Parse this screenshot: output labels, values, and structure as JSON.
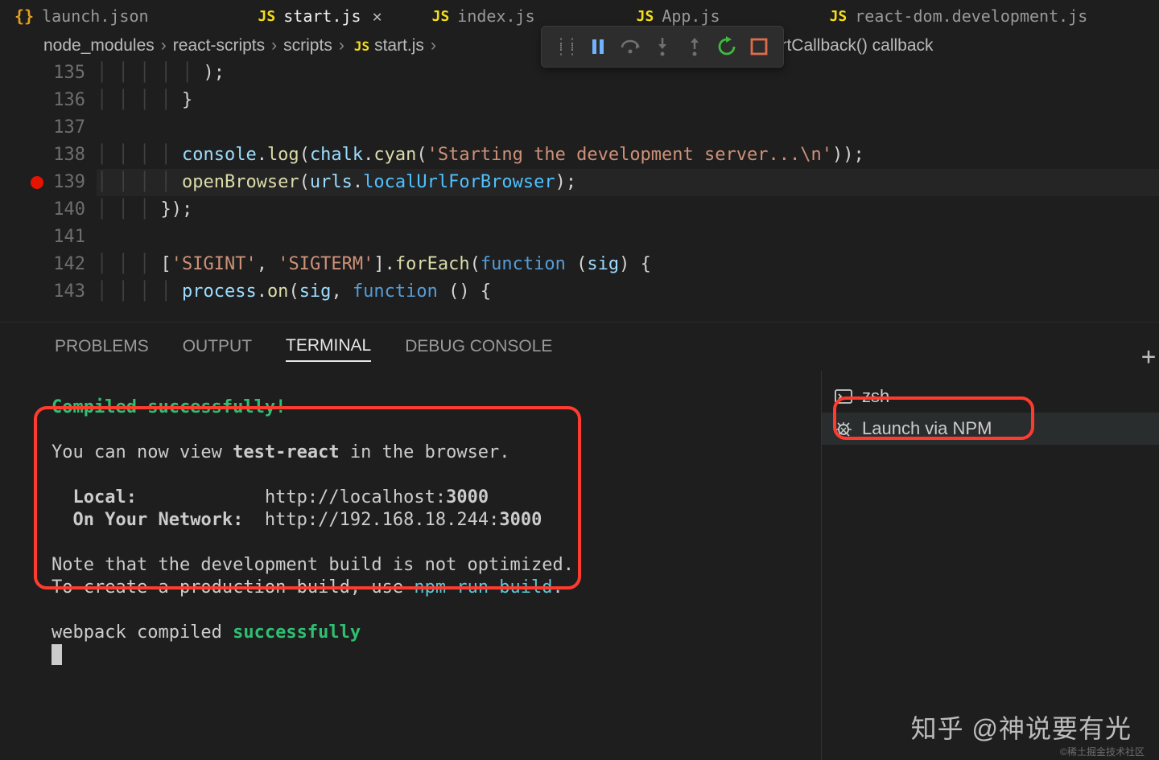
{
  "tabs": [
    {
      "icon": "{}",
      "label": "launch.json"
    },
    {
      "icon": "JS",
      "label": "start.js",
      "active": true
    },
    {
      "icon": "JS",
      "label": "index.js"
    },
    {
      "icon": "JS",
      "label": "App.js"
    },
    {
      "icon": "JS",
      "label": "react-dom.development.js"
    }
  ],
  "breadcrumb": {
    "parts": [
      "node_modules",
      "react-scripts",
      "scripts",
      "start.js"
    ],
    "js_icon": "JS",
    "tail": "erver.startCallback() callback"
  },
  "debug_toolbar": {
    "buttons": [
      "grip",
      "pause",
      "step-over",
      "step-into",
      "step-out",
      "restart",
      "stop"
    ]
  },
  "editor": {
    "lines": [
      {
        "num": "135",
        "indent": 5,
        "code_html": "<span class='tok-punc'>);</span>"
      },
      {
        "num": "136",
        "indent": 4,
        "code_html": "<span class='tok-punc'>}</span>"
      },
      {
        "num": "137",
        "indent": 0,
        "code_html": ""
      },
      {
        "num": "138",
        "indent": 4,
        "code_html": "<span class='tok-obj'>console</span><span class='tok-punc'>.</span><span class='tok-fn'>log</span><span class='tok-punc'>(</span><span class='tok-obj'>chalk</span><span class='tok-punc'>.</span><span class='tok-fn'>cyan</span><span class='tok-punc'>(</span><span class='tok-str'>'Starting the development server...\\n'</span><span class='tok-punc'>));</span>"
      },
      {
        "num": "139",
        "indent": 4,
        "bp": true,
        "hl": true,
        "code_html": "<span class='tok-fn'>openBrowser</span><span class='tok-punc'>(</span><span class='tok-obj'>urls</span><span class='tok-punc'>.</span><span class='tok-var'>localUrlForBrowser</span><span class='tok-punc'>);</span>"
      },
      {
        "num": "140",
        "indent": 3,
        "code_html": "<span class='tok-punc'>});</span>"
      },
      {
        "num": "141",
        "indent": 0,
        "code_html": ""
      },
      {
        "num": "142",
        "indent": 3,
        "code_html": "<span class='tok-punc'>[</span><span class='tok-str'>'SIGINT'</span><span class='tok-punc'>, </span><span class='tok-str'>'SIGTERM'</span><span class='tok-punc'>].</span><span class='tok-fn'>forEach</span><span class='tok-punc'>(</span><span class='tok-kw'>function</span><span class='tok-punc'> (</span><span class='tok-obj'>sig</span><span class='tok-punc'>) {</span>"
      },
      {
        "num": "143",
        "indent": 4,
        "code_html": "<span class='tok-obj'>process</span><span class='tok-punc'>.</span><span class='tok-fn'>on</span><span class='tok-punc'>(</span><span class='tok-obj'>sig</span><span class='tok-punc'>, </span><span class='tok-kw'>function</span><span class='tok-punc'> () {</span>"
      }
    ]
  },
  "panel": {
    "tabs": [
      "PROBLEMS",
      "OUTPUT",
      "TERMINAL",
      "DEBUG CONSOLE"
    ],
    "active": "TERMINAL",
    "side_items": [
      {
        "icon": "terminal",
        "label": "zsh"
      },
      {
        "icon": "bug",
        "label": "Launch via NPM",
        "active": true
      }
    ]
  },
  "terminal": {
    "l1": "Compiled successfully!",
    "l2a": "You can now view ",
    "l2b": "test-react",
    "l2c": " in the browser.",
    "local_label": "Local:",
    "local_pad": "            ",
    "local_url_a": "http://localhost:",
    "local_url_b": "3000",
    "net_label": "On Your Network:",
    "net_pad": "  ",
    "net_url_a": "http://192.168.18.244:",
    "net_url_b": "3000",
    "note1": "Note that the development build is not optimized.",
    "note2a": "To create a production build, use ",
    "note2b": "npm run build",
    "note2c": ".",
    "wp_a": "webpack compiled ",
    "wp_b": "successfully"
  },
  "watermark": "知乎 @神说要有光",
  "watermark_small": "©稀土掘金技术社区"
}
